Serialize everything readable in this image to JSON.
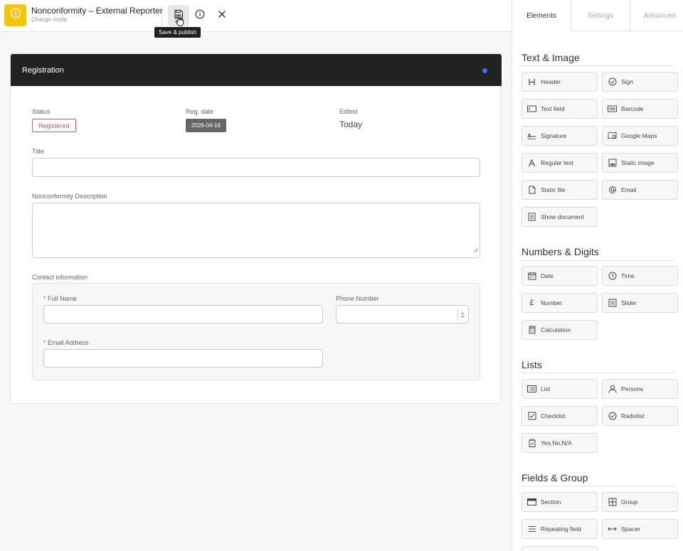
{
  "app": {
    "title": "Nonconformity – External Reporter",
    "mode": "Change mode",
    "tooltip": "Save & publish",
    "accent": "#f2c511"
  },
  "form": {
    "header_title": "Registration",
    "status_label": "Status",
    "status_value": "Registered",
    "reg_date_label": "Reg. date",
    "reg_date_value": "2026-04-16",
    "edited_label": "Edited",
    "edited_value": "Today",
    "title_label": "Title",
    "title_value": "",
    "description_label": "Nonconformity Description",
    "description_value": "",
    "contact_label": "Contact information",
    "full_name_label": "Full Name",
    "full_name_value": "",
    "phone_label": "Phone Number",
    "phone_value": "",
    "email_label": "Email Address",
    "email_value": "",
    "required_marker": "*"
  },
  "panel": {
    "tabs": [
      "Elements",
      "Settings",
      "Advanced"
    ],
    "sections": {
      "text_image": {
        "title": "Text & Image",
        "items": [
          "Header",
          "Sign",
          "Text field",
          "Barcode",
          "Signature",
          "Google Maps",
          "Regular text",
          "Static image",
          "Static file",
          "Email",
          "Show document"
        ]
      },
      "numbers": {
        "title": "Numbers & Digits",
        "items": [
          "Date",
          "Time",
          "Number",
          "Slider",
          "Calculation"
        ]
      },
      "lists": {
        "title": "Lists",
        "items": [
          "List",
          "Persons",
          "Checklist",
          "Radiolist",
          "Yes,No,N/A"
        ]
      },
      "fields_group": {
        "title": "Fields & Group",
        "items": [
          "Section",
          "Group",
          "Repeating field",
          "Spacer"
        ]
      }
    }
  }
}
